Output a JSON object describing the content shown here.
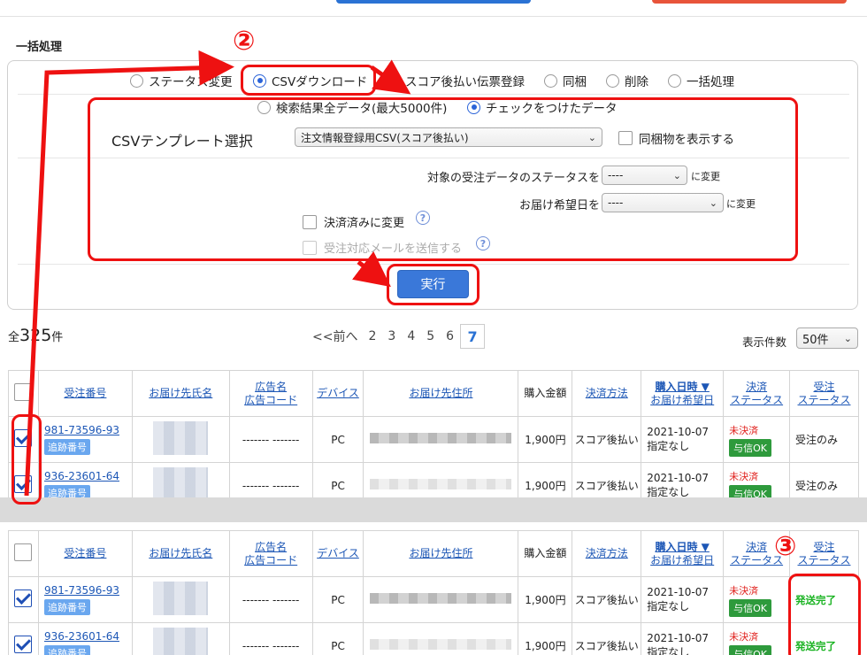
{
  "section": {
    "title": "一括処理"
  },
  "bulk_actions": {
    "options": [
      "ステータス変更",
      "CSVダウンロード",
      "スコア後払い伝票登録",
      "同梱",
      "削除",
      "一括処理"
    ],
    "selected_index": 1
  },
  "csv": {
    "scope_options": [
      "検索結果全データ(最大5000件)",
      "チェックをつけたデータ"
    ],
    "scope_selected_index": 1,
    "template_label": "CSVテンプレート選択",
    "template_value": "注文情報登録用CSV(スコア後払い)",
    "bundled_label": "同梱物を表示する",
    "status_change_label": "対象の受注データのステータスを",
    "status_change_value": "----",
    "change_suffix": "に変更",
    "delivery_date_label": "お届け希望日を",
    "delivery_date_value": "----",
    "paid_label": "決済済みに変更",
    "send_mail_label": "受注対応メールを送信する",
    "help_glyph": "?"
  },
  "execute_button": "実行",
  "results": {
    "total_prefix": "全",
    "total_count": "325",
    "total_suffix": "件",
    "pager_prev": "<<前へ",
    "pages": [
      "2",
      "3",
      "4",
      "5",
      "6",
      "7"
    ],
    "current_page": "7",
    "per_page_label": "表示件数",
    "per_page_value": "50件"
  },
  "table": {
    "headers": {
      "order_no": "受注番号",
      "name": "お届け先氏名",
      "ad_name": "広告名",
      "ad_code": "広告コード",
      "device": "デバイス",
      "address": "お届け先住所",
      "amount": "購入金額",
      "payment": "決済方法",
      "purchase_date": "購入日時 ▼",
      "delivery_date": "お届け希望日",
      "pay_status_1": "決済",
      "pay_status_2": "ステータス",
      "order_status_1": "受注",
      "order_status_2": "ステータス"
    },
    "tracking_badge": "追跡番号",
    "before_rows": [
      {
        "order_no": "981-73596-93",
        "ad": "------- -------",
        "device": "PC",
        "amount": "1,900円",
        "payment": "スコア後払い",
        "date": "2021-10-07",
        "delivery": "指定なし",
        "pay_status": "未決済",
        "credit": "与信OK",
        "order_status": "受注のみ"
      },
      {
        "order_no": "936-23601-64",
        "ad": "------- -------",
        "device": "PC",
        "amount": "1,900円",
        "payment": "スコア後払い",
        "date": "2021-10-07",
        "delivery": "指定なし",
        "pay_status": "未決済",
        "credit": "与信OK",
        "order_status": "受注のみ"
      }
    ],
    "after_rows": [
      {
        "order_no": "981-73596-93",
        "ad": "------- -------",
        "device": "PC",
        "amount": "1,900円",
        "payment": "スコア後払い",
        "date": "2021-10-07",
        "delivery": "指定なし",
        "pay_status": "未決済",
        "credit": "与信OK",
        "order_status": "発送完了"
      },
      {
        "order_no": "936-23601-64",
        "ad": "------- -------",
        "device": "PC",
        "amount": "1,900円",
        "payment": "スコア後払い",
        "date": "2021-10-07",
        "delivery": "指定なし",
        "pay_status": "未決済",
        "credit": "与信OK",
        "order_status": "発送完了"
      }
    ]
  },
  "annotations": {
    "step2": "②",
    "step3": "③",
    "color": "#ee1111"
  }
}
